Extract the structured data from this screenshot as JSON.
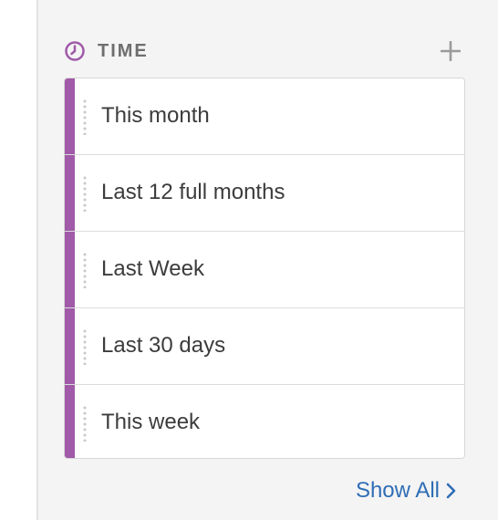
{
  "section": {
    "title": "TIME",
    "icon": "clock-icon",
    "add_icon": "plus-icon",
    "accent_color": "#a05aa8"
  },
  "items": [
    {
      "label": "This month"
    },
    {
      "label": "Last 12 full months"
    },
    {
      "label": "Last Week"
    },
    {
      "label": "Last 30 days"
    },
    {
      "label": "This week"
    }
  ],
  "footer": {
    "show_all_label": "Show All",
    "show_all_icon": "chevron-right-icon",
    "link_color": "#2f6db5"
  }
}
